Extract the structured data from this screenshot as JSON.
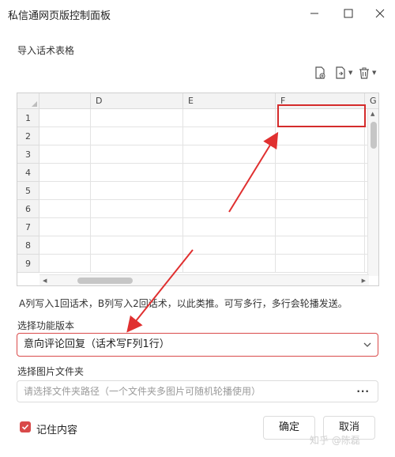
{
  "window": {
    "title": "私信通网页版控制面板",
    "controls": {
      "minimize": "—",
      "maximize": "☐",
      "close": "✕"
    }
  },
  "import": {
    "label": "导入话术表格",
    "toolbar_icons": [
      "add-file-icon",
      "import-file-icon",
      "trash-icon"
    ]
  },
  "sheet": {
    "columns": [
      "D",
      "E",
      "F",
      "G"
    ],
    "rows": [
      "1",
      "2",
      "3",
      "4",
      "5",
      "6",
      "7",
      "8",
      "9"
    ],
    "selected_cell": "F1"
  },
  "hint": "A列写入1回话术，B列写入2回话术，以此类推。可写多行，多行会轮播发送。",
  "version": {
    "label": "选择功能版本",
    "selected": "意向评论回复（话术写F列1行）"
  },
  "folder": {
    "label": "选择图片文件夹",
    "placeholder": "请选择文件夹路径（一个文件夹多图片可随机轮播使用）",
    "browse": "···"
  },
  "remember": {
    "label": "记住内容",
    "checked": true
  },
  "buttons": {
    "confirm": "确定",
    "cancel": "取消"
  },
  "watermark": "知乎 @陈磊",
  "colors": {
    "accent": "#d94a4a"
  }
}
